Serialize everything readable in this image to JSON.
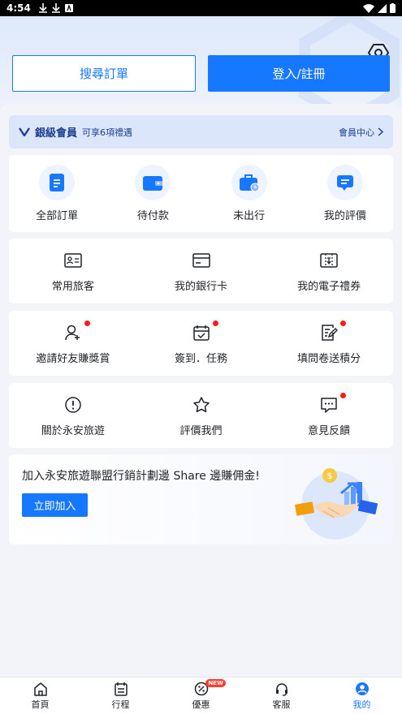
{
  "status_bar": {
    "time": "4:54"
  },
  "header": {
    "search_orders_label": "搜尋訂單",
    "login_label": "登入/註冊"
  },
  "member": {
    "level": "銀級會員",
    "benefits": "可享6項禮遇",
    "center_link": "會員中心"
  },
  "orders": [
    {
      "label": "全部訂單",
      "icon": "document-icon"
    },
    {
      "label": "待付款",
      "icon": "wallet-icon"
    },
    {
      "label": "未出行",
      "icon": "suitcase-icon"
    },
    {
      "label": "我的評價",
      "icon": "chat-icon"
    }
  ],
  "services": [
    {
      "label": "常用旅客",
      "icon": "id-card-icon"
    },
    {
      "label": "我的銀行卡",
      "icon": "bank-card-icon"
    },
    {
      "label": "我的電子禮券",
      "icon": "gift-voucher-icon"
    }
  ],
  "activities": [
    {
      "label": "邀請好友賺獎賞",
      "icon": "add-user-icon",
      "dot": true
    },
    {
      "label": "簽到．任務",
      "icon": "calendar-check-icon",
      "dot": true
    },
    {
      "label": "填問卷送積分",
      "icon": "survey-icon",
      "dot": true
    }
  ],
  "about": [
    {
      "label": "關於永安旅遊",
      "icon": "info-icon",
      "dot": false
    },
    {
      "label": "評價我們",
      "icon": "star-icon",
      "dot": false
    },
    {
      "label": "意見反饋",
      "icon": "feedback-icon",
      "dot": true
    }
  ],
  "banner": {
    "title": "加入永安旅遊聯盟行銷計劃邊 Share 邊賺佣金!",
    "button": "立即加入"
  },
  "tabs": [
    {
      "label": "首頁",
      "icon": "home-icon",
      "active": false
    },
    {
      "label": "行程",
      "icon": "itinerary-icon",
      "active": false
    },
    {
      "label": "優惠",
      "icon": "offers-icon",
      "active": false,
      "badge": "NEW"
    },
    {
      "label": "客服",
      "icon": "headset-icon",
      "active": false
    },
    {
      "label": "我的",
      "icon": "profile-icon",
      "active": true
    }
  ],
  "colors": {
    "primary": "#1677ff",
    "member_bg": "#dbe6fb",
    "member_text": "#1d3f8f",
    "dot": "#ff1a1a"
  }
}
